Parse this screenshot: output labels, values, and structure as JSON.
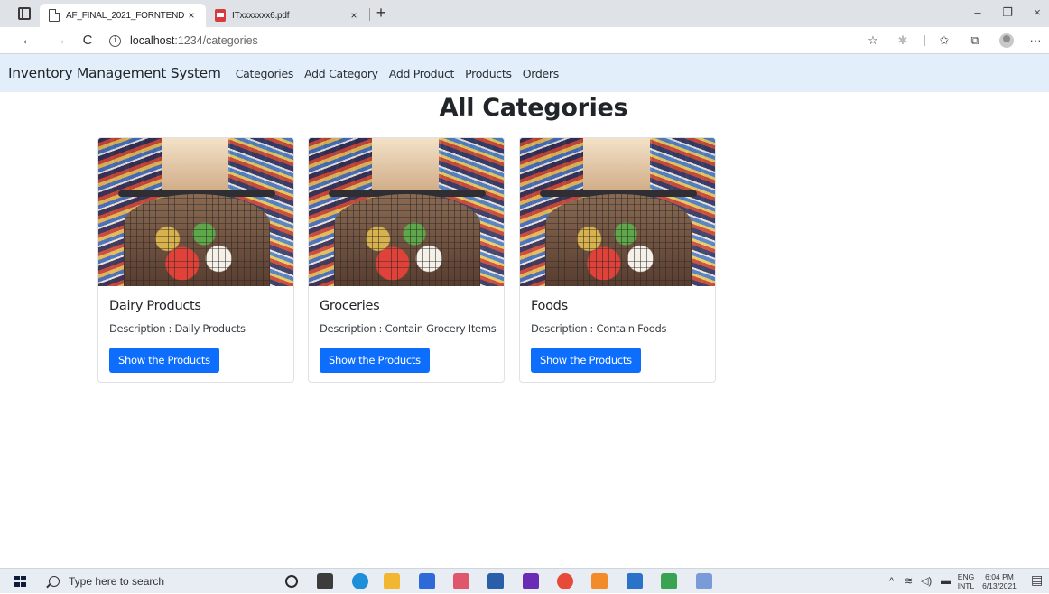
{
  "browser": {
    "tabs": [
      {
        "title": "AF_FINAL_2021_FORNTEND",
        "close": "×",
        "active": true
      },
      {
        "title": "ITxxxxxxx6.pdf",
        "close": "×",
        "active": false
      }
    ],
    "new_tab": "+",
    "window_controls": {
      "minimize": "–",
      "maximize": "❐",
      "close": "×"
    },
    "nav": {
      "back": "←",
      "forward": "→",
      "reload": "C"
    },
    "url_host": "localhost",
    "url_rest": ":1234/categories",
    "info": "i",
    "more": "···"
  },
  "app": {
    "brand": "Inventory Management System",
    "nav_links": [
      {
        "label": "Categories"
      },
      {
        "label": "Add Category"
      },
      {
        "label": "Add Product"
      },
      {
        "label": "Products"
      },
      {
        "label": "Orders"
      }
    ],
    "page_title": "All Categories",
    "categories": [
      {
        "title": "Dairy Products",
        "description": "Description : Daily Products",
        "button": "Show the Products"
      },
      {
        "title": "Groceries",
        "description": "Description : Contain Grocery Items",
        "button": "Show the Products"
      },
      {
        "title": "Foods",
        "description": "Description : Contain Foods",
        "button": "Show the Products"
      }
    ]
  },
  "taskbar": {
    "search_placeholder": "Type here to search",
    "language_top": "ENG",
    "language_bottom": "INTL",
    "time": "6:04 PM",
    "date": "6/13/2021",
    "app_colors": [
      "#2a2a2a",
      "#3c3c3c",
      "#1f8fd8",
      "#f2b630",
      "#2d6ad8",
      "#e0566a",
      "#2b5ea8",
      "#6a2bb5",
      "#e84a3a",
      "#f28c28",
      "#2b73c8",
      "#3aa352",
      "#7a9ad8"
    ]
  }
}
